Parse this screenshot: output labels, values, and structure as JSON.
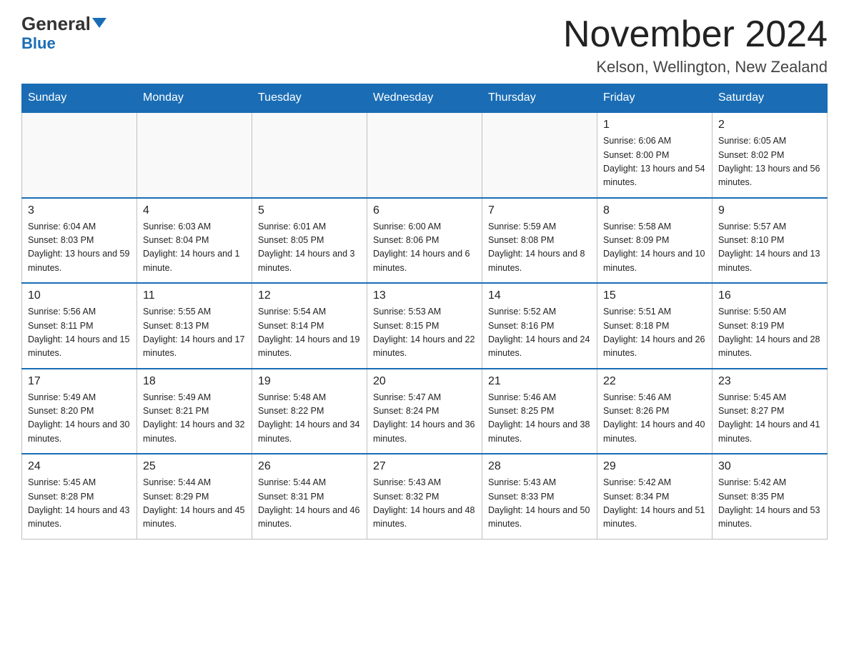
{
  "header": {
    "logo_general": "General",
    "logo_blue": "Blue",
    "month_title": "November 2024",
    "location": "Kelson, Wellington, New Zealand"
  },
  "weekdays": [
    "Sunday",
    "Monday",
    "Tuesday",
    "Wednesday",
    "Thursday",
    "Friday",
    "Saturday"
  ],
  "weeks": [
    [
      {
        "day": "",
        "sunrise": "",
        "sunset": "",
        "daylight": ""
      },
      {
        "day": "",
        "sunrise": "",
        "sunset": "",
        "daylight": ""
      },
      {
        "day": "",
        "sunrise": "",
        "sunset": "",
        "daylight": ""
      },
      {
        "day": "",
        "sunrise": "",
        "sunset": "",
        "daylight": ""
      },
      {
        "day": "",
        "sunrise": "",
        "sunset": "",
        "daylight": ""
      },
      {
        "day": "1",
        "sunrise": "Sunrise: 6:06 AM",
        "sunset": "Sunset: 8:00 PM",
        "daylight": "Daylight: 13 hours and 54 minutes."
      },
      {
        "day": "2",
        "sunrise": "Sunrise: 6:05 AM",
        "sunset": "Sunset: 8:02 PM",
        "daylight": "Daylight: 13 hours and 56 minutes."
      }
    ],
    [
      {
        "day": "3",
        "sunrise": "Sunrise: 6:04 AM",
        "sunset": "Sunset: 8:03 PM",
        "daylight": "Daylight: 13 hours and 59 minutes."
      },
      {
        "day": "4",
        "sunrise": "Sunrise: 6:03 AM",
        "sunset": "Sunset: 8:04 PM",
        "daylight": "Daylight: 14 hours and 1 minute."
      },
      {
        "day": "5",
        "sunrise": "Sunrise: 6:01 AM",
        "sunset": "Sunset: 8:05 PM",
        "daylight": "Daylight: 14 hours and 3 minutes."
      },
      {
        "day": "6",
        "sunrise": "Sunrise: 6:00 AM",
        "sunset": "Sunset: 8:06 PM",
        "daylight": "Daylight: 14 hours and 6 minutes."
      },
      {
        "day": "7",
        "sunrise": "Sunrise: 5:59 AM",
        "sunset": "Sunset: 8:08 PM",
        "daylight": "Daylight: 14 hours and 8 minutes."
      },
      {
        "day": "8",
        "sunrise": "Sunrise: 5:58 AM",
        "sunset": "Sunset: 8:09 PM",
        "daylight": "Daylight: 14 hours and 10 minutes."
      },
      {
        "day": "9",
        "sunrise": "Sunrise: 5:57 AM",
        "sunset": "Sunset: 8:10 PM",
        "daylight": "Daylight: 14 hours and 13 minutes."
      }
    ],
    [
      {
        "day": "10",
        "sunrise": "Sunrise: 5:56 AM",
        "sunset": "Sunset: 8:11 PM",
        "daylight": "Daylight: 14 hours and 15 minutes."
      },
      {
        "day": "11",
        "sunrise": "Sunrise: 5:55 AM",
        "sunset": "Sunset: 8:13 PM",
        "daylight": "Daylight: 14 hours and 17 minutes."
      },
      {
        "day": "12",
        "sunrise": "Sunrise: 5:54 AM",
        "sunset": "Sunset: 8:14 PM",
        "daylight": "Daylight: 14 hours and 19 minutes."
      },
      {
        "day": "13",
        "sunrise": "Sunrise: 5:53 AM",
        "sunset": "Sunset: 8:15 PM",
        "daylight": "Daylight: 14 hours and 22 minutes."
      },
      {
        "day": "14",
        "sunrise": "Sunrise: 5:52 AM",
        "sunset": "Sunset: 8:16 PM",
        "daylight": "Daylight: 14 hours and 24 minutes."
      },
      {
        "day": "15",
        "sunrise": "Sunrise: 5:51 AM",
        "sunset": "Sunset: 8:18 PM",
        "daylight": "Daylight: 14 hours and 26 minutes."
      },
      {
        "day": "16",
        "sunrise": "Sunrise: 5:50 AM",
        "sunset": "Sunset: 8:19 PM",
        "daylight": "Daylight: 14 hours and 28 minutes."
      }
    ],
    [
      {
        "day": "17",
        "sunrise": "Sunrise: 5:49 AM",
        "sunset": "Sunset: 8:20 PM",
        "daylight": "Daylight: 14 hours and 30 minutes."
      },
      {
        "day": "18",
        "sunrise": "Sunrise: 5:49 AM",
        "sunset": "Sunset: 8:21 PM",
        "daylight": "Daylight: 14 hours and 32 minutes."
      },
      {
        "day": "19",
        "sunrise": "Sunrise: 5:48 AM",
        "sunset": "Sunset: 8:22 PM",
        "daylight": "Daylight: 14 hours and 34 minutes."
      },
      {
        "day": "20",
        "sunrise": "Sunrise: 5:47 AM",
        "sunset": "Sunset: 8:24 PM",
        "daylight": "Daylight: 14 hours and 36 minutes."
      },
      {
        "day": "21",
        "sunrise": "Sunrise: 5:46 AM",
        "sunset": "Sunset: 8:25 PM",
        "daylight": "Daylight: 14 hours and 38 minutes."
      },
      {
        "day": "22",
        "sunrise": "Sunrise: 5:46 AM",
        "sunset": "Sunset: 8:26 PM",
        "daylight": "Daylight: 14 hours and 40 minutes."
      },
      {
        "day": "23",
        "sunrise": "Sunrise: 5:45 AM",
        "sunset": "Sunset: 8:27 PM",
        "daylight": "Daylight: 14 hours and 41 minutes."
      }
    ],
    [
      {
        "day": "24",
        "sunrise": "Sunrise: 5:45 AM",
        "sunset": "Sunset: 8:28 PM",
        "daylight": "Daylight: 14 hours and 43 minutes."
      },
      {
        "day": "25",
        "sunrise": "Sunrise: 5:44 AM",
        "sunset": "Sunset: 8:29 PM",
        "daylight": "Daylight: 14 hours and 45 minutes."
      },
      {
        "day": "26",
        "sunrise": "Sunrise: 5:44 AM",
        "sunset": "Sunset: 8:31 PM",
        "daylight": "Daylight: 14 hours and 46 minutes."
      },
      {
        "day": "27",
        "sunrise": "Sunrise: 5:43 AM",
        "sunset": "Sunset: 8:32 PM",
        "daylight": "Daylight: 14 hours and 48 minutes."
      },
      {
        "day": "28",
        "sunrise": "Sunrise: 5:43 AM",
        "sunset": "Sunset: 8:33 PM",
        "daylight": "Daylight: 14 hours and 50 minutes."
      },
      {
        "day": "29",
        "sunrise": "Sunrise: 5:42 AM",
        "sunset": "Sunset: 8:34 PM",
        "daylight": "Daylight: 14 hours and 51 minutes."
      },
      {
        "day": "30",
        "sunrise": "Sunrise: 5:42 AM",
        "sunset": "Sunset: 8:35 PM",
        "daylight": "Daylight: 14 hours and 53 minutes."
      }
    ]
  ]
}
